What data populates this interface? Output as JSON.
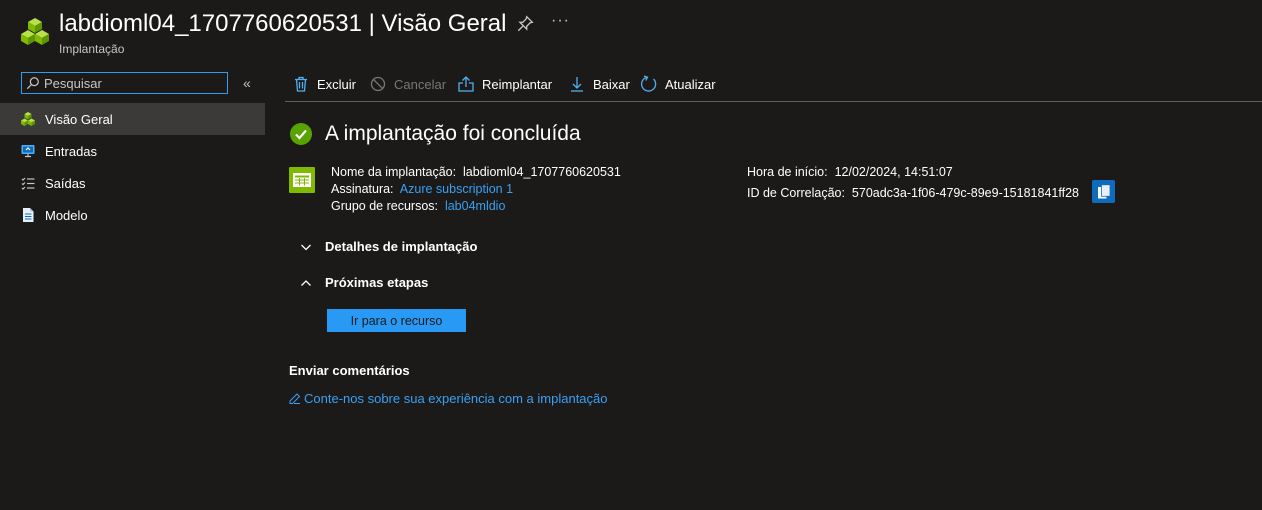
{
  "header": {
    "title": "labdioml04_1707760620531 | Visão Geral",
    "subtitle": "Implantação",
    "icon": "resource-group-cubes-icon",
    "more_label": "···"
  },
  "search": {
    "placeholder": "Pesquisar",
    "value": "",
    "collapse_label": "«"
  },
  "sidebar": {
    "items": [
      {
        "label": "Visão Geral",
        "icon": "overview-icon",
        "active": true
      },
      {
        "label": "Entradas",
        "icon": "inputs-icon",
        "active": false
      },
      {
        "label": "Saídas",
        "icon": "outputs-icon",
        "active": false
      },
      {
        "label": "Modelo",
        "icon": "template-icon",
        "active": false
      }
    ]
  },
  "toolbar": {
    "delete_label": "Excluir",
    "cancel_label": "Cancelar",
    "redeploy_label": "Reimplantar",
    "download_label": "Baixar",
    "refresh_label": "Atualizar"
  },
  "status": {
    "title": "A implantação foi concluída",
    "state": "success"
  },
  "details": {
    "deployment_name_label": "Nome da implantação:",
    "deployment_name": "labdioml04_1707760620531",
    "subscription_label": "Assinatura:",
    "subscription": "Azure subscription 1",
    "resource_group_label": "Grupo de recursos:",
    "resource_group": "lab04mldio",
    "start_time_label": "Hora de início:",
    "start_time": "12/02/2024, 14:51:07",
    "correlation_label": "ID de Correlação:",
    "correlation_id": "570adc3a-1f06-479c-89e9-15181841ff28"
  },
  "sections": {
    "deployment_details": "Detalhes de implantação",
    "next_steps": "Próximas etapas"
  },
  "go_to_resource_label": "Ir para o recurso",
  "feedback": {
    "title": "Enviar comentários",
    "link": "Conte-nos sobre sua experiência com a implantação"
  },
  "colors": {
    "background": "#1b1a19",
    "accent": "#2899f5",
    "link": "#3aa0f3",
    "success": "#57a300",
    "active_nav": "#3b3a39"
  }
}
